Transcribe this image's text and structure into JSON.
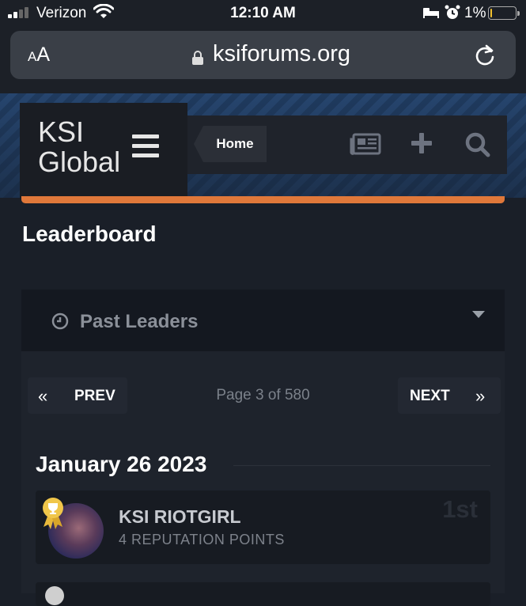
{
  "status_bar": {
    "carrier": "Verizon",
    "time": "12:10 AM",
    "battery_percent": "1%",
    "battery_level": 0.01,
    "signal_bars": 2,
    "icons": [
      "signal-icon",
      "wifi-icon",
      "sleep-icon",
      "alarm-icon",
      "battery-icon"
    ]
  },
  "browser": {
    "text_size_label_small": "A",
    "text_size_label_large": "A",
    "url": "ksiforums.org",
    "icons": [
      "lock-icon",
      "reload-icon"
    ]
  },
  "site_header": {
    "logo_line1": "KSI",
    "logo_line2": "Global",
    "home_tab": "Home",
    "icons": [
      "hamburger-icon",
      "newspaper-icon",
      "plus-icon",
      "search-icon"
    ],
    "accent_color": "#e0783a"
  },
  "page": {
    "title": "Leaderboard",
    "past_leaders_label": "Past Leaders",
    "pagination": {
      "prev_label": "PREV",
      "next_label": "NEXT",
      "prev_arrow": "«",
      "next_arrow": "»",
      "page_info": "Page 3 of 580"
    },
    "date_heading": "January 26 2023",
    "leaders": [
      {
        "name": "KSI RIOTGIRL",
        "points": "4 REPUTATION POINTS",
        "rank": "1st"
      }
    ]
  }
}
